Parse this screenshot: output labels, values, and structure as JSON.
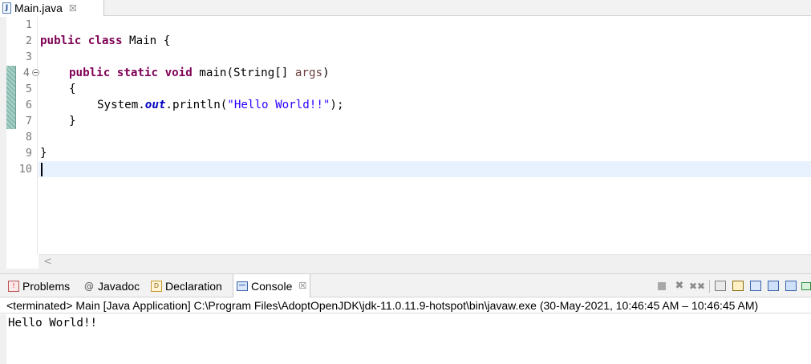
{
  "editor": {
    "tab": {
      "label": "Main.java",
      "icon": "java-file-icon",
      "close_glyph": "☒"
    },
    "line_numbers": [
      "1",
      "2",
      "3",
      "4",
      "5",
      "6",
      "7",
      "8",
      "9",
      "10"
    ],
    "code": {
      "line2": {
        "kw_public": "public",
        "kw_class": "class",
        "rest": " Main {"
      },
      "line4": {
        "kw_public": "public",
        "kw_static": "static",
        "kw_void": "void",
        "method": " main(String[] ",
        "param": "args",
        "close": ")"
      },
      "line5": {
        "text": "{"
      },
      "line6": {
        "prefix": "System.",
        "field": "out",
        "call": ".println(",
        "string": "\"Hello World!!\"",
        "end": ");"
      },
      "line7": {
        "text": "}"
      },
      "line9": {
        "text": "}"
      }
    },
    "scroll_left_glyph": "<"
  },
  "views": {
    "tabs": [
      {
        "label": "Problems",
        "icon": "problems-icon"
      },
      {
        "label": "Javadoc",
        "icon": "javadoc-icon",
        "glyph": "@"
      },
      {
        "label": "Declaration",
        "icon": "declaration-icon"
      },
      {
        "label": "Console",
        "icon": "console-icon",
        "active": true,
        "close_glyph": "☒"
      }
    ],
    "toolbar": {
      "remove_glyph": "✖",
      "remove_all_glyph": "✖✖"
    }
  },
  "console": {
    "header": "<terminated> Main [Java Application] C:\\Program Files\\AdoptOpenJDK\\jdk-11.0.11.9-hotspot\\bin\\javaw.exe  (30-May-2021, 10:46:45 AM – 10:46:45 AM)",
    "output": "Hello World!!"
  },
  "colors": {
    "keyword": "#7f0055",
    "string": "#2a00ff",
    "static_field": "#0000c0",
    "parameter": "#6a3e3e",
    "current_line": "#e8f2fe"
  }
}
